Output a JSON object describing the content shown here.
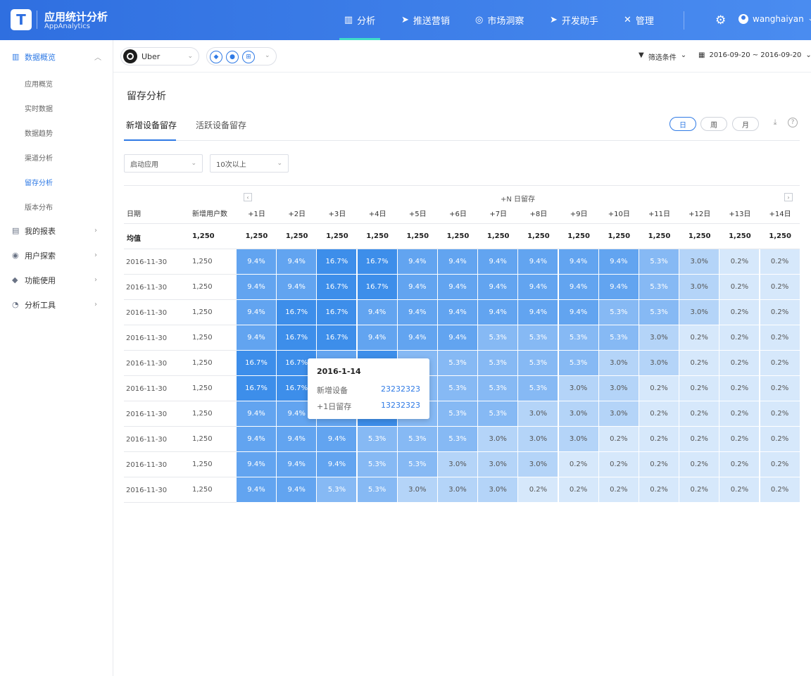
{
  "header": {
    "logo_letter": "T",
    "app_title": "应用统计分析",
    "app_subtitle": "AppAnalytics",
    "nav": [
      {
        "label": "分析",
        "icon": "bar-chart-icon",
        "active": true
      },
      {
        "label": "推送营销",
        "icon": "send-icon",
        "active": false
      },
      {
        "label": "市场洞察",
        "icon": "target-icon",
        "active": false
      },
      {
        "label": "开发助手",
        "icon": "send-icon",
        "active": false
      },
      {
        "label": "管理",
        "icon": "tools-icon",
        "active": false
      }
    ],
    "username": "wanghaiyan"
  },
  "sidebar": {
    "groups": [
      {
        "label": "数据概览",
        "icon": "bar-chart-icon",
        "expanded": true,
        "active": true
      },
      {
        "label": "我的报表",
        "icon": "report-icon"
      },
      {
        "label": "用户探索",
        "icon": "compass-icon"
      },
      {
        "label": "功能使用",
        "icon": "cube-icon"
      },
      {
        "label": "分析工具",
        "icon": "pie-icon"
      }
    ],
    "subitems": [
      "应用概览",
      "实时数据",
      "数据趋势",
      "渠道分析",
      "留存分析",
      "版本分布"
    ],
    "active_subitem": "留存分析"
  },
  "filterbar": {
    "app_name": "Uber",
    "platforms": [
      "android",
      "apple",
      "windows"
    ],
    "filter_label": "筛选条件",
    "date_range": "2016-09-20 ~ 2016-09-20"
  },
  "main": {
    "page_title": "留存分析",
    "tabs": [
      {
        "label": "新增设备留存",
        "active": true
      },
      {
        "label": "活跃设备留存",
        "active": false
      }
    ],
    "periods": [
      {
        "label": "日",
        "active": true
      },
      {
        "label": "周",
        "active": false
      },
      {
        "label": "月",
        "active": false
      }
    ],
    "dropdown_event": "启动应用",
    "dropdown_times": "10次以上",
    "table": {
      "group_title": "+N 日留存",
      "col_date": "日期",
      "col_new": "新增用户数",
      "day_headers": [
        "+1日",
        "+2日",
        "+3日",
        "+4日",
        "+5日",
        "+6日",
        "+7日",
        "+8日",
        "+9日",
        "+10日",
        "+11日",
        "+12日",
        "+13日",
        "+14日"
      ],
      "avg_label": "均值",
      "avg_new": "1,250",
      "avg_values": [
        "1,250",
        "1,250",
        "1,250",
        "1,250",
        "1,250",
        "1,250",
        "1,250",
        "1,250",
        "1,250",
        "1,250",
        "1,250",
        "1,250",
        "1,250",
        "1,250"
      ],
      "rows": [
        {
          "date": "2016-11-30",
          "new": "1,250",
          "values": [
            "9.4%",
            "9.4%",
            "16.7%",
            "16.7%",
            "9.4%",
            "9.4%",
            "9.4%",
            "9.4%",
            "9.4%",
            "9.4%",
            "5.3%",
            "3.0%",
            "0.2%",
            "0.2%"
          ]
        },
        {
          "date": "2016-11-30",
          "new": "1,250",
          "values": [
            "9.4%",
            "9.4%",
            "16.7%",
            "16.7%",
            "9.4%",
            "9.4%",
            "9.4%",
            "9.4%",
            "9.4%",
            "9.4%",
            "5.3%",
            "3.0%",
            "0.2%",
            "0.2%"
          ]
        },
        {
          "date": "2016-11-30",
          "new": "1,250",
          "values": [
            "9.4%",
            "16.7%",
            "16.7%",
            "9.4%",
            "9.4%",
            "9.4%",
            "9.4%",
            "9.4%",
            "9.4%",
            "5.3%",
            "5.3%",
            "3.0%",
            "0.2%",
            "0.2%"
          ]
        },
        {
          "date": "2016-11-30",
          "new": "1,250",
          "values": [
            "9.4%",
            "16.7%",
            "16.7%",
            "9.4%",
            "9.4%",
            "9.4%",
            "5.3%",
            "5.3%",
            "5.3%",
            "5.3%",
            "3.0%",
            "0.2%",
            "0.2%",
            "0.2%"
          ]
        },
        {
          "date": "2016-11-30",
          "new": "1,250",
          "values": [
            "16.7%",
            "16.7%",
            "",
            "",
            "",
            "5.3%",
            "5.3%",
            "5.3%",
            "5.3%",
            "3.0%",
            "3.0%",
            "0.2%",
            "0.2%",
            "0.2%"
          ]
        },
        {
          "date": "2016-11-30",
          "new": "1,250",
          "values": [
            "16.7%",
            "16.7%",
            "",
            "",
            "",
            "5.3%",
            "5.3%",
            "5.3%",
            "3.0%",
            "3.0%",
            "0.2%",
            "0.2%",
            "0.2%",
            "0.2%"
          ]
        },
        {
          "date": "2016-11-30",
          "new": "1,250",
          "values": [
            "9.4%",
            "9.4%",
            "",
            "",
            "",
            "5.3%",
            "5.3%",
            "3.0%",
            "3.0%",
            "3.0%",
            "0.2%",
            "0.2%",
            "0.2%",
            "0.2%"
          ]
        },
        {
          "date": "2016-11-30",
          "new": "1,250",
          "values": [
            "9.4%",
            "9.4%",
            "9.4%",
            "5.3%",
            "5.3%",
            "5.3%",
            "3.0%",
            "3.0%",
            "3.0%",
            "0.2%",
            "0.2%",
            "0.2%",
            "0.2%",
            "0.2%"
          ]
        },
        {
          "date": "2016-11-30",
          "new": "1,250",
          "values": [
            "9.4%",
            "9.4%",
            "9.4%",
            "5.3%",
            "5.3%",
            "3.0%",
            "3.0%",
            "3.0%",
            "0.2%",
            "0.2%",
            "0.2%",
            "0.2%",
            "0.2%",
            "0.2%"
          ]
        },
        {
          "date": "2016-11-30",
          "new": "1,250",
          "values": [
            "9.4%",
            "9.4%",
            "5.3%",
            "5.3%",
            "3.0%",
            "3.0%",
            "3.0%",
            "0.2%",
            "0.2%",
            "0.2%",
            "0.2%",
            "0.2%",
            "0.2%",
            "0.2%"
          ]
        }
      ],
      "hidden_cell_levels": [
        "9.4%",
        "16.7%",
        "5.3%"
      ]
    },
    "tooltip": {
      "date": "2016-1-14",
      "new_label": "新增设备",
      "new_value": "23232323",
      "retention_label": "+1日留存",
      "retention_value": "13232323"
    }
  },
  "colors": {
    "accent": "#2f7ae5",
    "level_16_7": "#3d8eea",
    "level_9_4": "#62a4f0",
    "level_5_3": "#86b9f4",
    "level_3_0": "#b4d4f8",
    "level_0_2": "#d6e8fb"
  }
}
